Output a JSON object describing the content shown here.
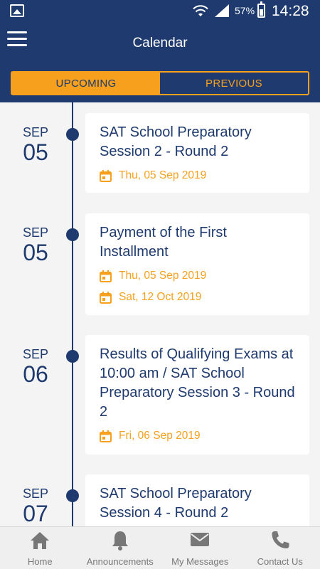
{
  "status_bar": {
    "battery": "57%",
    "time": "14:28"
  },
  "header": {
    "title": "Calendar"
  },
  "tabs": [
    {
      "label": "UPCOMING",
      "active": true
    },
    {
      "label": "PREVIOUS",
      "active": false
    }
  ],
  "events": [
    {
      "month": "SEP",
      "day": "05",
      "title": "SAT School Preparatory Session 2 - Round 2",
      "dates": [
        "Thu, 05 Sep 2019"
      ]
    },
    {
      "month": "SEP",
      "day": "05",
      "title": "Payment of the First Installment",
      "dates": [
        "Thu, 05 Sep 2019",
        "Sat, 12 Oct 2019"
      ]
    },
    {
      "month": "SEP",
      "day": "06",
      "title": "Results of Qualifying Exams at 10:00 am / SAT School Preparatory Session 3 - Round 2",
      "dates": [
        "Fri, 06 Sep 2019"
      ]
    },
    {
      "month": "SEP",
      "day": "07",
      "title": "SAT School Preparatory Session 4 - Round 2",
      "dates": []
    }
  ],
  "bottom_nav": [
    {
      "label": "Home",
      "icon": "home-icon"
    },
    {
      "label": "Announcements",
      "icon": "bell-icon"
    },
    {
      "label": "My Messages",
      "icon": "mail-icon"
    },
    {
      "label": "Contact Us",
      "icon": "phone-icon"
    }
  ],
  "colors": {
    "primary": "#1e3a6e",
    "accent": "#f7a01e",
    "background": "#f4f4f4"
  }
}
